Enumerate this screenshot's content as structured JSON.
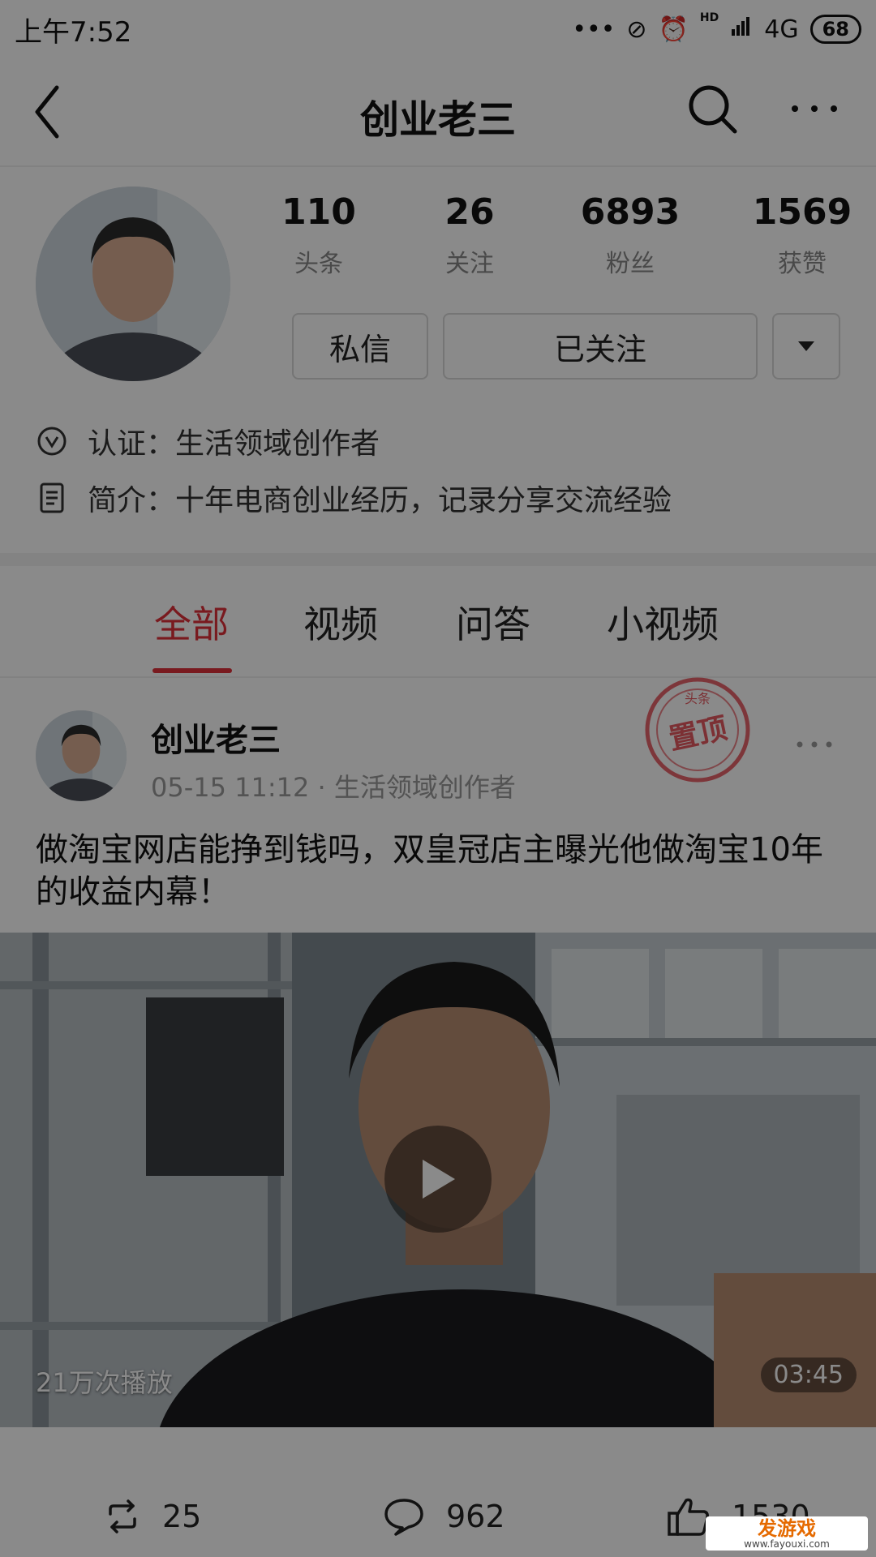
{
  "status_bar": {
    "time": "上午7:52",
    "network": "4G",
    "hd": "HD",
    "battery": "68"
  },
  "nav": {
    "title": "创业老三"
  },
  "profile": {
    "stats": [
      {
        "value": "110",
        "label": "头条"
      },
      {
        "value": "26",
        "label": "关注"
      },
      {
        "value": "6893",
        "label": "粉丝"
      },
      {
        "value": "1569",
        "label": "获赞"
      }
    ],
    "message_label": "私信",
    "follow_label": "已关注",
    "verification": "认证：生活领域创作者",
    "bio": "简介：十年电商创业经历，记录分享交流经验"
  },
  "tabs": [
    {
      "label": "全部",
      "active": true
    },
    {
      "label": "视频",
      "active": false
    },
    {
      "label": "问答",
      "active": false
    },
    {
      "label": "小视频",
      "active": false
    }
  ],
  "post": {
    "author": "创业老三",
    "meta": "05-15 11:12 · 生活领域创作者",
    "pinned_stamp": "置顶",
    "stamp_small": "头条",
    "text": "做淘宝网店能挣到钱吗，双皇冠店主曝光他做淘宝10年的收益内幕！",
    "video": {
      "views": "21万次播放",
      "duration": "03:45"
    },
    "actions": {
      "repost": "25",
      "comments": "962",
      "likes": "1530"
    }
  },
  "watermark": {
    "main": "发游戏",
    "sub": "www.fayouxi.com"
  },
  "colors": {
    "accent": "#e0303a",
    "dim_overlay": "rgba(0,0,0,0.46)"
  }
}
